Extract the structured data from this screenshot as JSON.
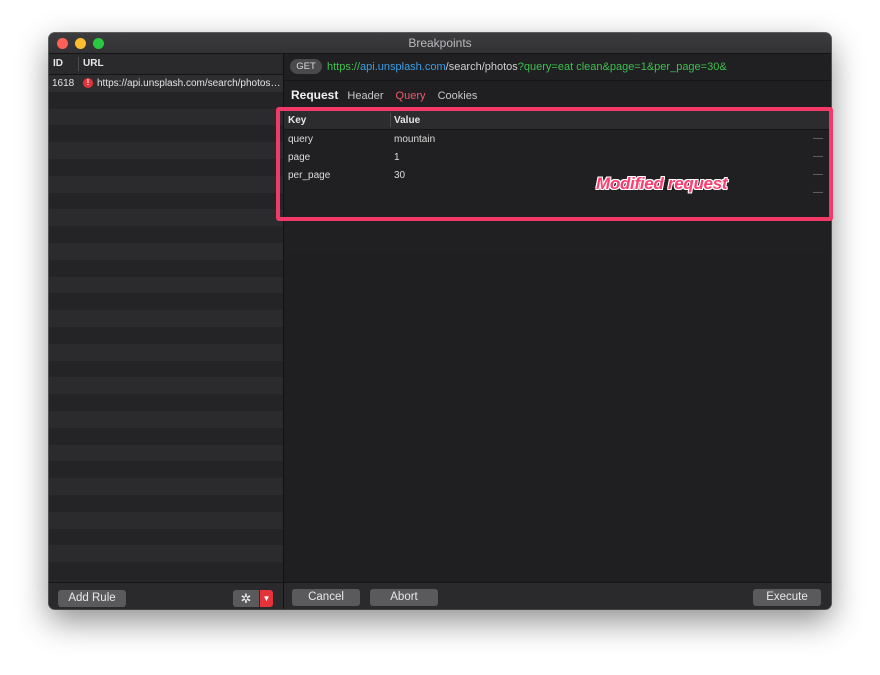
{
  "window": {
    "title": "Breakpoints"
  },
  "left": {
    "columns": {
      "id": "ID",
      "url": "URL"
    },
    "requests": [
      {
        "id": "1618",
        "url": "https://api.unsplash.com/search/photos?query=eat clean&page=1&per_page=30&",
        "status_icon": "error-icon"
      }
    ],
    "add_rule_label": "Add Rule",
    "settings_icon": "gear-icon",
    "dropdown_icon": "chevron-down-icon"
  },
  "request": {
    "method": "GET",
    "url": {
      "scheme": "https://",
      "host": "api.unsplash.com",
      "path": "/search/photos",
      "query": "?query=eat clean&page=1&per_page=30&"
    },
    "tabs": {
      "title": "Request",
      "items": [
        "Header",
        "Query",
        "Cookies"
      ],
      "active": "Query"
    },
    "query_table": {
      "columns": {
        "key": "Key",
        "value": "Value"
      },
      "rows": [
        {
          "key": "query",
          "value": "mountain"
        },
        {
          "key": "page",
          "value": "1"
        },
        {
          "key": "per_page",
          "value": "30"
        }
      ],
      "remove_glyph": "—"
    }
  },
  "footer": {
    "cancel_label": "Cancel",
    "abort_label": "Abort",
    "execute_label": "Execute"
  },
  "annotation": {
    "text": "Modified request",
    "color": "#f2396a"
  },
  "colors": {
    "active_tab": "#ef5a6a",
    "url_green": "#3fbf4f",
    "url_blue": "#3c9ee6",
    "error_red": "#e5333a"
  }
}
